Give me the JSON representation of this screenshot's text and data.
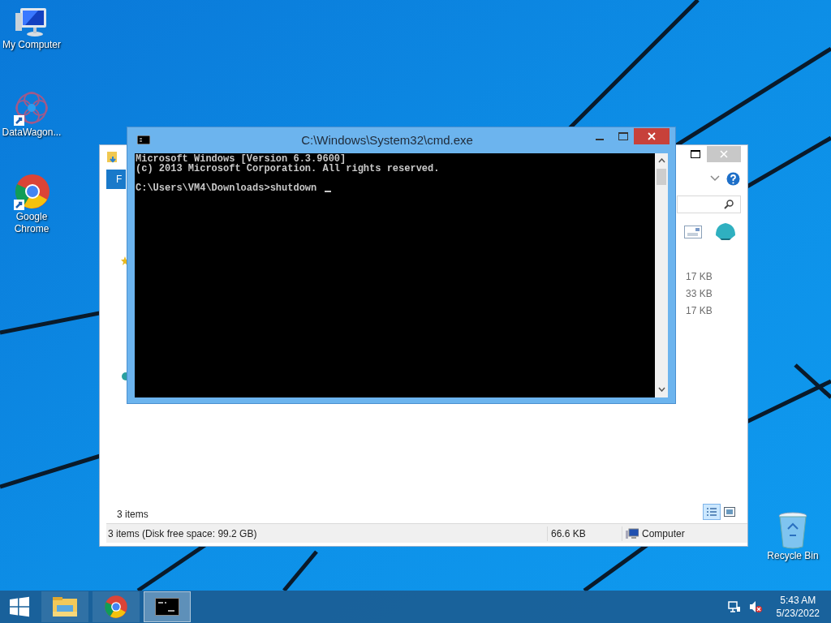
{
  "desktop_icons": [
    {
      "label": "My Computer",
      "kind": "computer"
    },
    {
      "label": "DataWagon...",
      "kind": "app"
    },
    {
      "label": "Google Chrome",
      "kind": "chrome"
    },
    {
      "label": "Recycle Bin",
      "kind": "bin"
    }
  ],
  "explorer": {
    "ribbon_tab": "F",
    "sizes": [
      "17 KB",
      "33 KB",
      "17 KB"
    ],
    "item_count": "3 items",
    "views": [
      {
        "kind": "details",
        "selected": true
      },
      {
        "kind": "large",
        "selected": false
      }
    ],
    "status": {
      "summary": "3 items (Disk free space: 99.2 GB)",
      "size": "66.6 KB",
      "location": "Computer"
    }
  },
  "console": {
    "title": "C:\\Windows\\System32\\cmd.exe",
    "lines": [
      "Microsoft Windows [Version 6.3.9600]",
      "(c) 2013 Microsoft Corporation. All rights reserved."
    ],
    "prompt": "C:\\Users\\VM4\\Downloads>shutdown"
  },
  "taskbar": {
    "apps": [
      {
        "kind": "explorer",
        "selected": false
      },
      {
        "kind": "chrome",
        "selected": false
      },
      {
        "kind": "cmd",
        "selected": true
      }
    ],
    "clock": {
      "time": "5:43 AM",
      "date": "5/23/2022"
    }
  }
}
